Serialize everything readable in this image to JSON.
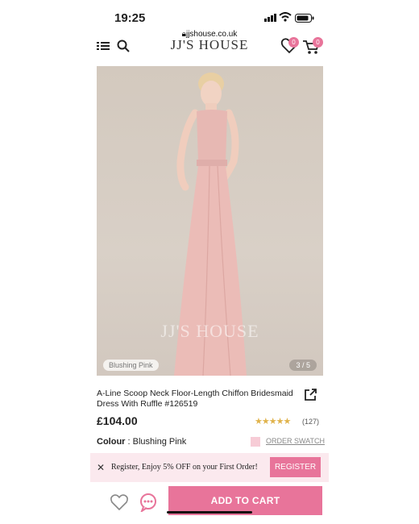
{
  "status_bar": {
    "time": "19:25"
  },
  "browser": {
    "url": "jjshouse.co.uk"
  },
  "header": {
    "logo": "JJ'S HOUSE",
    "wishlist_count": "0",
    "cart_count": "0"
  },
  "gallery": {
    "watermark": "JJ'S HOUSE",
    "color_tag": "Blushing Pink",
    "counter": "3 / 5"
  },
  "product": {
    "title": "A-Line Scoop Neck Floor-Length Chiffon Bridesmaid Dress With Ruffle #126519",
    "price": "£104.00",
    "stars": "★★★★★",
    "rating_fraction": 0.9,
    "review_count": "(127)",
    "colour_label": "Colour",
    "colour_sep": " : ",
    "colour_value": "Blushing Pink",
    "swatch_color": "#f7ccd6",
    "order_swatch": "ORDER SWATCH"
  },
  "promo": {
    "close": "✕",
    "text": "Register, Enjoy 5% OFF on your First Order!",
    "button": "REGISTER"
  },
  "actions": {
    "add_to_cart": "ADD TO CART"
  },
  "colors": {
    "accent": "#e8749a",
    "promo_bg": "#fbe9ee"
  }
}
